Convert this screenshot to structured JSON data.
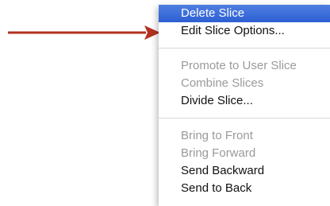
{
  "menu": {
    "items": [
      {
        "label": "Delete Slice",
        "state": "selected"
      },
      {
        "label": "Edit Slice Options...",
        "state": "enabled"
      },
      {
        "label": "Promote to User Slice",
        "state": "disabled"
      },
      {
        "label": "Combine Slices",
        "state": "disabled"
      },
      {
        "label": "Divide Slice...",
        "state": "enabled"
      },
      {
        "label": "Bring to Front",
        "state": "disabled"
      },
      {
        "label": "Bring Forward",
        "state": "disabled"
      },
      {
        "label": "Send Backward",
        "state": "enabled"
      },
      {
        "label": "Send to Back",
        "state": "enabled"
      }
    ]
  },
  "colors": {
    "highlight": "#2d5fd3",
    "arrow": "#b3321f",
    "disabled_text": "#9a9a9a"
  }
}
